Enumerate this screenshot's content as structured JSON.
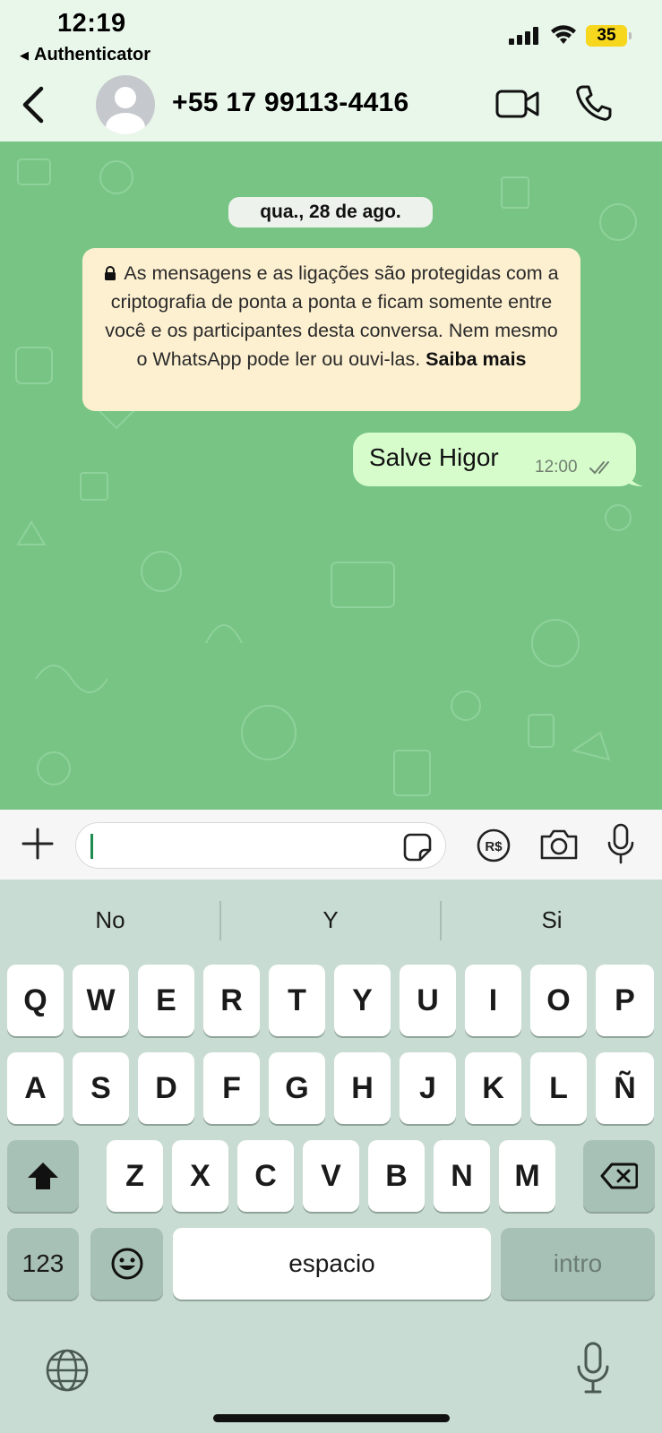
{
  "status_bar": {
    "time": "12:19",
    "back_app": "Authenticator",
    "battery": "35"
  },
  "header": {
    "contact": "+55 17 99113-4416"
  },
  "chat": {
    "date": "qua., 28 de ago.",
    "encryption_notice": "As mensagens e as ligações são protegidas com a criptografia de ponta a ponta e ficam somente entre você e os participantes desta conversa. Nem mesmo o WhatsApp pode ler ou ouvi-las.",
    "encryption_link": "Saiba mais",
    "messages": [
      {
        "text": "Salve Higor",
        "time": "12:00",
        "status": "read"
      }
    ]
  },
  "input": {
    "placeholder": "",
    "value": ""
  },
  "keyboard": {
    "suggestions": [
      "No",
      "Y",
      "Si"
    ],
    "row1": [
      "Q",
      "W",
      "E",
      "R",
      "T",
      "Y",
      "U",
      "I",
      "O",
      "P"
    ],
    "row2": [
      "A",
      "S",
      "D",
      "F",
      "G",
      "H",
      "J",
      "K",
      "L",
      "Ñ"
    ],
    "row3": [
      "Z",
      "X",
      "C",
      "V",
      "B",
      "N",
      "M"
    ],
    "numbers_key": "123",
    "space_key": "espacio",
    "return_key": "intro"
  },
  "colors": {
    "header_bg": "#e9f7ea",
    "chat_bg": "#77c485",
    "outgoing_bubble": "#d7fccc",
    "notice_bg": "#fdf0d0",
    "keyboard_bg": "#c9dcd3"
  }
}
